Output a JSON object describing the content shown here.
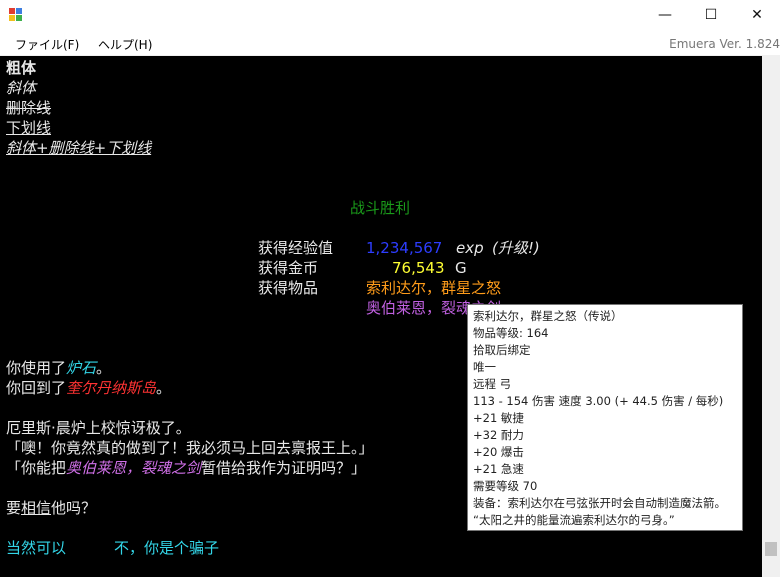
{
  "window": {
    "minimize": "—",
    "maximize": "☐",
    "close": "✕"
  },
  "menu": {
    "file": "ファイル(F)",
    "help": "ヘルプ(H)",
    "version": "Emuera Ver. 1.824"
  },
  "console": {
    "bold": "粗体",
    "italic": "斜体",
    "strike": "删除线",
    "underline": "下划线",
    "combo": "斜体+删除线+下划线",
    "victory": "战斗胜利",
    "exp_label": "获得经验值",
    "exp_value": "1,234,567",
    "exp_unit": "exp",
    "levelup": "(升级!)",
    "gold_label": "获得金币",
    "gold_value": "76,543",
    "gold_unit": "G",
    "items_label": "获得物品",
    "item1": "索利达尔，群星之怒",
    "item2": "奥伯莱恩，裂魂之剑",
    "you_used": "你使用了",
    "hearthstone": "炉石",
    "period": "。",
    "you_returned": "你回到了",
    "island": "奎尔丹纳斯岛",
    "npc_line": "厄里斯·晨炉上校惊讶极了。",
    "quote1": "「噢！你竟然真的做到了！我必须马上回去禀报王上。」",
    "quote2_a": "「你能把",
    "quote2_item": "奥伯莱恩，裂魂之剑",
    "quote2_b": "暂借给我作为证明吗？」",
    "question_a": "要",
    "question_link": "相信",
    "question_b": "他吗？",
    "choice_yes": "当然可以",
    "choice_no": "不，你是个骗子"
  },
  "tooltip": {
    "lines": [
      "索利达尔，群星之怒（传说）",
      "物品等级: 164",
      "拾取后绑定",
      "唯一",
      "远程 弓",
      "113 - 154 伤害 速度 3.00 (+ 44.5 伤害 / 每秒)",
      "+21 敏捷",
      "+32 耐力",
      "+20 爆击",
      "+21 急速",
      "需要等级 70",
      "装备：索利达尔在弓弦张开时会自动制造魔法箭。",
      "“太阳之井的能量流遍索利达尔的弓身。”"
    ]
  },
  "colors": {
    "victory": "#1a9a1a",
    "exp_value": "#2d3dff",
    "gold_value": "#ffff33",
    "item1": "#ff9c1a",
    "item2": "#c060e0",
    "cyan": "#33d6e8",
    "red": "#ff3333",
    "magenta": "#d070e8"
  }
}
